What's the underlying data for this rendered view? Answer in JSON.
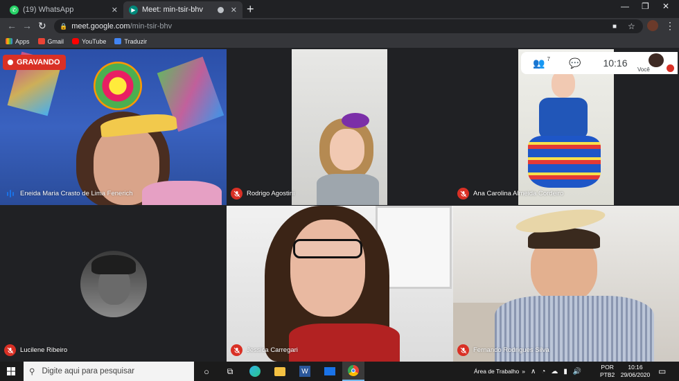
{
  "browser": {
    "tabs": [
      {
        "title": "(19) WhatsApp",
        "icon": "whatsapp-icon"
      },
      {
        "title": "Meet: min-tsir-bhv",
        "icon": "meet-icon"
      }
    ],
    "url_host": "meet.google.com",
    "url_path": "/min-tsir-bhv",
    "bookmarks": [
      {
        "label": "Apps",
        "icon": "apps-icon"
      },
      {
        "label": "Gmail",
        "icon": "gmail-icon"
      },
      {
        "label": "YouTube",
        "icon": "youtube-icon"
      },
      {
        "label": "Traduzir",
        "icon": "translate-icon"
      }
    ]
  },
  "meet": {
    "recording_label": "GRAVANDO",
    "participant_count": "7",
    "clock": "10:16",
    "self_label": "Você",
    "participants": [
      {
        "name": "Eneida Maria Crasto de Lima Fenerich",
        "muted": false
      },
      {
        "name": "Rodrigo Agostini",
        "muted": true
      },
      {
        "name": "Ana Carolina Almeida Cordeiro",
        "muted": true
      },
      {
        "name": "Lucilene Ribeiro",
        "muted": true
      },
      {
        "name": "Jessica Carregari",
        "muted": true
      },
      {
        "name": "Fernando Rodrigues Silva",
        "muted": true
      }
    ]
  },
  "taskbar": {
    "search_placeholder": "Digite aqui para pesquisar",
    "desktop_label": "Área de Trabalho",
    "language": "POR",
    "keyboard": "PTB2",
    "time": "10:16",
    "date": "29/06/2020"
  },
  "colors": {
    "accent_red": "#d93025",
    "meet_bg": "#202124"
  }
}
